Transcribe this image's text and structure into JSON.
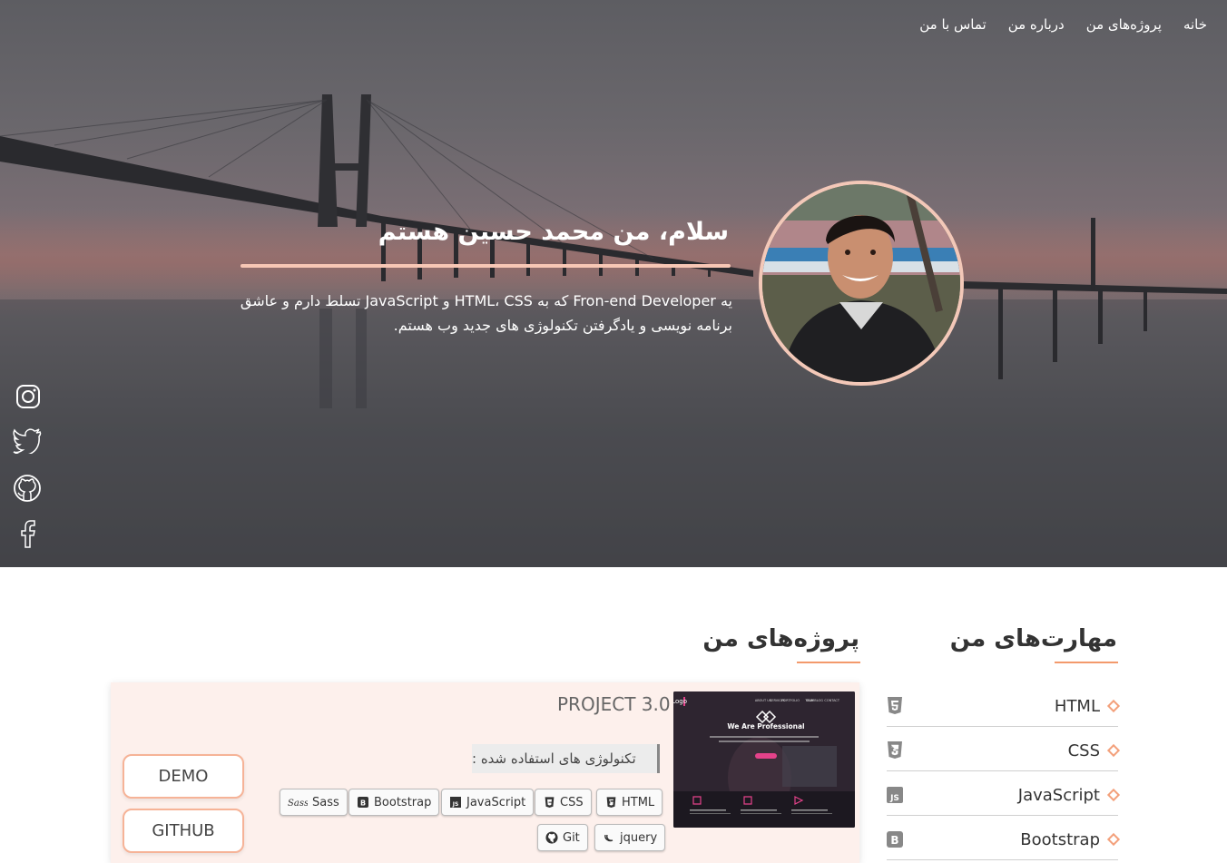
{
  "nav": {
    "items": [
      "خانه",
      "پروژه‌های من",
      "درباره من",
      "تماس با من"
    ]
  },
  "hero": {
    "title": "سلام، من محمد حسین هستم",
    "description": "یه Fron-end Developer که به HTML، CSS و JavaScript تسلط دارم و عاشق برنامه نویسی و یادگرفتن تکنولوژی های جدید وب هستم.",
    "accent_color": "#f7c7b5"
  },
  "socials": [
    "instagram-icon",
    "twitter-icon",
    "github-icon",
    "facebook-icon"
  ],
  "skills": {
    "title": "مهارت‌های من",
    "items": [
      {
        "name": "HTML",
        "icon": "html5-icon"
      },
      {
        "name": "CSS",
        "icon": "css3-icon"
      },
      {
        "name": "JavaScript",
        "icon": "js-icon"
      },
      {
        "name": "Bootstrap",
        "icon": "bootstrap-icon"
      }
    ]
  },
  "projects": {
    "title": "پروژه‌های من",
    "card": {
      "title": "PROJECT 3.0",
      "tech_label": "تکنولوژی های استفاده شده :",
      "tech": [
        "HTML",
        "CSS",
        "JavaScript",
        "Bootstrap",
        "Sass",
        "jquery",
        "Git"
      ],
      "buttons": {
        "demo": "DEMO",
        "github": "GITHUB"
      },
      "screenshot": {
        "logo": "Logo",
        "menu": [
          "ABOUT US",
          "SERVICES",
          "PORTFOLIO",
          "TEAM",
          "OUR BLOG",
          "CONTACT"
        ],
        "headline": "We Are Professional"
      }
    }
  },
  "colors": {
    "accent": "#f39a6c",
    "button_border": "#f6b397",
    "card_bg": "#fdf0ec"
  }
}
